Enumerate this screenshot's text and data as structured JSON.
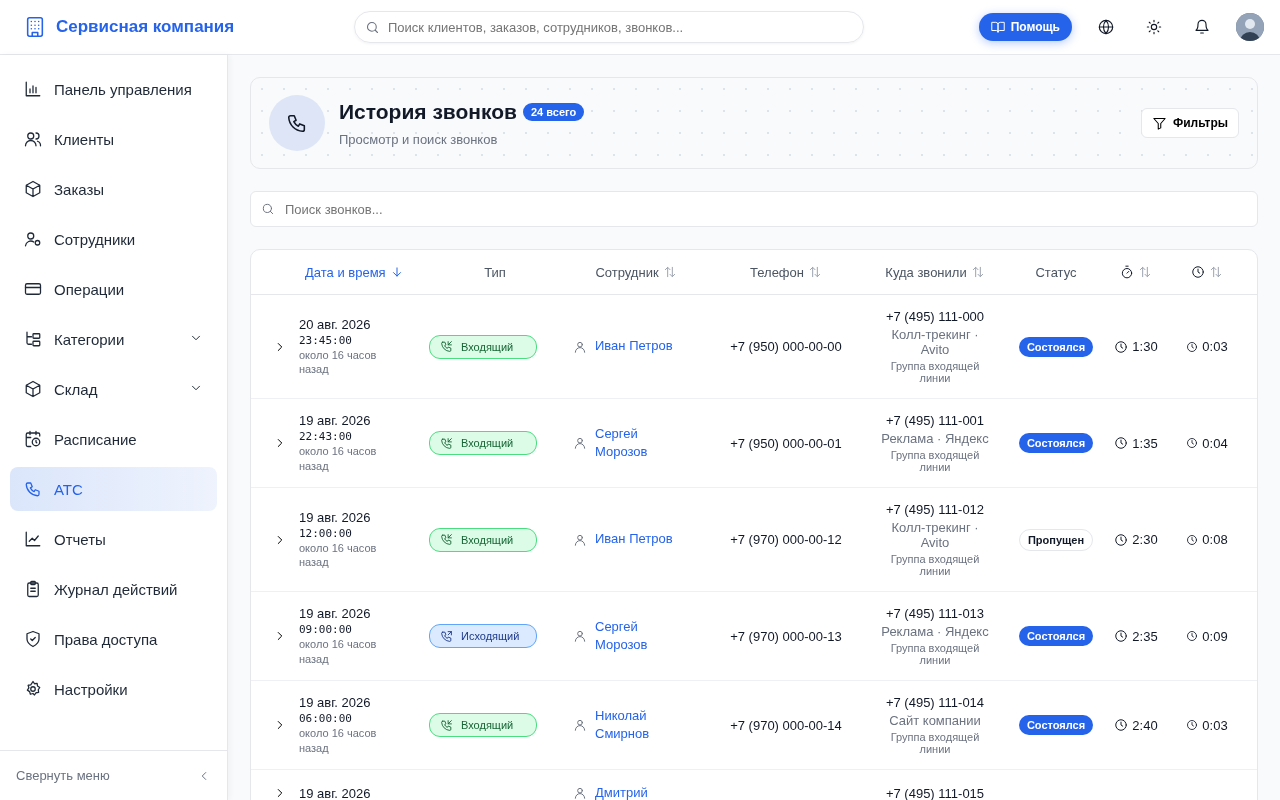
{
  "app": {
    "title": "Сервисная компания"
  },
  "search": {
    "placeholder": "Поиск клиентов, заказов, сотрудников, звонков..."
  },
  "help_button": "Помощь",
  "sidebar": {
    "items": [
      {
        "label": "Панель управления",
        "selected": false
      },
      {
        "label": "Клиенты",
        "selected": false
      },
      {
        "label": "Заказы",
        "selected": false
      },
      {
        "label": "Сотрудники",
        "selected": false
      },
      {
        "label": "Операции",
        "selected": false
      },
      {
        "label": "Категории",
        "selected": false,
        "expanded": false
      },
      {
        "label": "Склад",
        "selected": false,
        "expanded": false
      },
      {
        "label": "Расписание",
        "selected": false
      },
      {
        "label": "АТС",
        "selected": true
      },
      {
        "label": "Отчеты",
        "selected": false
      },
      {
        "label": "Журнал действий",
        "selected": false
      },
      {
        "label": "Права доступа",
        "selected": false
      },
      {
        "label": "Настройки",
        "selected": false
      }
    ],
    "collapse": "Свернуть меню"
  },
  "page": {
    "title": "История звонков",
    "count": "24 всего",
    "subtitle": "Просмотр и поиск звонков",
    "filter_button": "Фильтры"
  },
  "call_search": {
    "placeholder": "Поиск звонков..."
  },
  "table": {
    "columns": [
      {
        "kind": "text",
        "label": "Дата и время",
        "sortable": true,
        "sorted": true
      },
      {
        "kind": "text",
        "label": "Тип",
        "sortable": false,
        "sorted": false
      },
      {
        "kind": "text",
        "label": "Сотрудник",
        "sortable": true,
        "sorted": false
      },
      {
        "kind": "text",
        "label": "Телефон",
        "sortable": true,
        "sorted": false
      },
      {
        "kind": "text",
        "label": "Куда звонили",
        "sortable": true,
        "sorted": false
      },
      {
        "kind": "text",
        "label": "Статус",
        "sortable": false,
        "sorted": false
      },
      {
        "kind": "stopwatch",
        "sortable": true,
        "sorted": false
      },
      {
        "kind": "clock",
        "sortable": true,
        "sorted": false
      }
    ],
    "rows": [
      {
        "date": "20 авг. 2026",
        "time": "23:45:00",
        "ago": "около 16 часов назад",
        "type": {
          "kind": "incoming",
          "label": "Входящий"
        },
        "employee": "Иван Петров",
        "phone": "+7 (950) 000-00-00",
        "dest_number": "+7 (495) 111-000",
        "dest_source": "Колл-трекинг · Avito",
        "dest_group": "Группа входящей линии",
        "status": {
          "kind": "done",
          "label": "Состоялся"
        },
        "duration": "1:30",
        "wait": "0:03"
      },
      {
        "date": "19 авг. 2026",
        "time": "22:43:00",
        "ago": "около 16 часов назад",
        "type": {
          "kind": "incoming",
          "label": "Входящий"
        },
        "employee": "Сергей Морозов",
        "phone": "+7 (950) 000-00-01",
        "dest_number": "+7 (495) 111-001",
        "dest_source": "Реклама · Яндекс",
        "dest_group": "Группа входящей линии",
        "status": {
          "kind": "done",
          "label": "Состоялся"
        },
        "duration": "1:35",
        "wait": "0:04"
      },
      {
        "date": "19 авг. 2026",
        "time": "12:00:00",
        "ago": "около 16 часов назад",
        "type": {
          "kind": "incoming",
          "label": "Входящий"
        },
        "employee": "Иван Петров",
        "phone": "+7 (970) 000-00-12",
        "dest_number": "+7 (495) 111-012",
        "dest_source": "Колл-трекинг · Avito",
        "dest_group": "Группа входящей линии",
        "status": {
          "kind": "missed",
          "label": "Пропущен"
        },
        "duration": "2:30",
        "wait": "0:08"
      },
      {
        "date": "19 авг. 2026",
        "time": "09:00:00",
        "ago": "около 16 часов назад",
        "type": {
          "kind": "outgoing",
          "label": "Исходящий"
        },
        "employee": "Сергей Морозов",
        "phone": "+7 (970) 000-00-13",
        "dest_number": "+7 (495) 111-013",
        "dest_source": "Реклама · Яндекс",
        "dest_group": "Группа входящей линии",
        "status": {
          "kind": "done",
          "label": "Состоялся"
        },
        "duration": "2:35",
        "wait": "0:09"
      },
      {
        "date": "19 авг. 2026",
        "time": "06:00:00",
        "ago": "около 16 часов назад",
        "type": {
          "kind": "incoming",
          "label": "Входящий"
        },
        "employee": "Николай Смирнов",
        "phone": "+7 (970) 000-00-14",
        "dest_number": "+7 (495) 111-014",
        "dest_source": "Сайт компании",
        "dest_group": "Группа входящей линии",
        "status": {
          "kind": "done",
          "label": "Состоялся"
        },
        "duration": "2:40",
        "wait": "0:03"
      },
      {
        "date": "19 авг. 2026",
        "employee": "Дмитрий",
        "dest_number": "+7 (495) 111-015"
      }
    ]
  }
}
